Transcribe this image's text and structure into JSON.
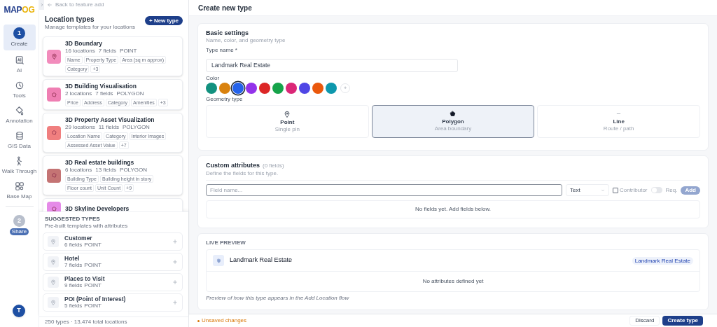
{
  "logo": {
    "primary": "MAP",
    "accent": "OG"
  },
  "rail": {
    "steps": [
      {
        "number": "1",
        "label": "Create",
        "selected": true
      },
      {
        "number": "2",
        "label": "Share",
        "selected": false
      }
    ],
    "tools": [
      {
        "kind": "ai",
        "label": "AI"
      },
      {
        "kind": "tools",
        "label": "Tools"
      },
      {
        "kind": "annotation",
        "label": "Annotation"
      },
      {
        "kind": "gis",
        "label": "GIS Data"
      },
      {
        "kind": "walk",
        "label": "Walk Through"
      },
      {
        "kind": "basemap",
        "label": "Base Map"
      }
    ],
    "avatar": "T"
  },
  "panel": {
    "back_link": "Back to feature add",
    "title": "Location types",
    "subtitle": "Manage templates for your locations",
    "new_button": "+ New type",
    "types": [
      {
        "name": "3D Boundary",
        "color": "#f28cbc",
        "kind": "point",
        "meta": [
          "16 locations",
          "7 fields",
          "POINT"
        ],
        "tags": [
          "Name",
          "Property Type",
          "Area (sq m approx)",
          "Category",
          "+3"
        ]
      },
      {
        "name": "3D Building Visualisation",
        "color": "#ef7fb3",
        "kind": "polygon",
        "meta": [
          "2 locations",
          "7 fields",
          "POLYGON"
        ],
        "tags": [
          "Price",
          "Address",
          "Category",
          "Amenities",
          "+3"
        ]
      },
      {
        "name": "3D Property Asset Visualization",
        "color": "#f07f7f",
        "kind": "polygon",
        "meta": [
          "29 locations",
          "11 fields",
          "POLYGON"
        ],
        "tags": [
          "Location Name",
          "Category",
          "Interior Images",
          "Assessed Asset Value",
          "+7"
        ]
      },
      {
        "name": "3D Real estate buildings",
        "color": "#c47474",
        "kind": "polygon",
        "meta": [
          "6 locations",
          "13 fields",
          "POLYGON"
        ],
        "tags": [
          "Building Type",
          "Building height in story",
          "Floor count",
          "Unit Count",
          "+9"
        ]
      },
      {
        "name": "3D Skyline Developers",
        "color": "#e58be8",
        "kind": "polygon"
      }
    ],
    "suggested": {
      "title": "SUGGESTED TYPES",
      "subtitle": "Pre-built templates with attributes",
      "items": [
        {
          "name": "Customer",
          "fields": "6 fields",
          "geometry": "POINT"
        },
        {
          "name": "Hotel",
          "fields": "7 fields",
          "geometry": "POINT"
        },
        {
          "name": "Places to Visit",
          "fields": "9 fields",
          "geometry": "POINT"
        },
        {
          "name": "POI (Point of Interest)",
          "fields": "5 fields",
          "geometry": "POINT"
        }
      ]
    },
    "footer": "250 types · 13,474 total locations"
  },
  "main": {
    "title": "Create new type",
    "basic": {
      "title": "Basic settings",
      "subtitle": "Name, color, and geometry type",
      "name_label": "Type name *",
      "name_value": "Landmark Real Estate",
      "color_label": "Color",
      "colors": [
        {
          "color": "#12917f",
          "selected": false
        },
        {
          "color": "#d9820e",
          "selected": false
        },
        {
          "color": "#2563eb",
          "selected": true
        },
        {
          "color": "#9333ea",
          "selected": false
        },
        {
          "color": "#dc2626",
          "selected": false
        },
        {
          "color": "#16a34a",
          "selected": false
        },
        {
          "color": "#db2777",
          "selected": false
        },
        {
          "color": "#4f46e5",
          "selected": false
        },
        {
          "color": "#ea580c",
          "selected": false
        },
        {
          "color": "#0e98ad",
          "selected": false
        }
      ],
      "add_color": "+",
      "geometry_label": "Geometry type",
      "geometries": [
        {
          "kind": "point",
          "label": "Point",
          "hint": "Single pin",
          "selected": false
        },
        {
          "kind": "polygon",
          "label": "Polygon",
          "hint": "Area boundary",
          "selected": true
        },
        {
          "kind": "line",
          "label": "Line",
          "hint": "Route / path",
          "selected": false
        }
      ]
    },
    "attributes": {
      "title": "Custom attributes",
      "count": "(0 fields)",
      "subtitle": "Define the fields for this type.",
      "field_placeholder": "Field name...",
      "type_value": "Text",
      "contributor_label": "Contributor",
      "contributor_checked": false,
      "required_on": false,
      "required_label": "Req.",
      "add_button": "Add",
      "empty": "No fields yet. Add fields below."
    },
    "preview": {
      "title": "LIVE PREVIEW",
      "name": "Landmark Real Estate",
      "badge": "Landmark Real Estate",
      "empty": "No attributes defined yet",
      "note": "Preview of how this type appears in the Add Location flow"
    },
    "footer": {
      "status": "Unsaved changes",
      "discard": "Discard",
      "create": "Create type"
    }
  }
}
